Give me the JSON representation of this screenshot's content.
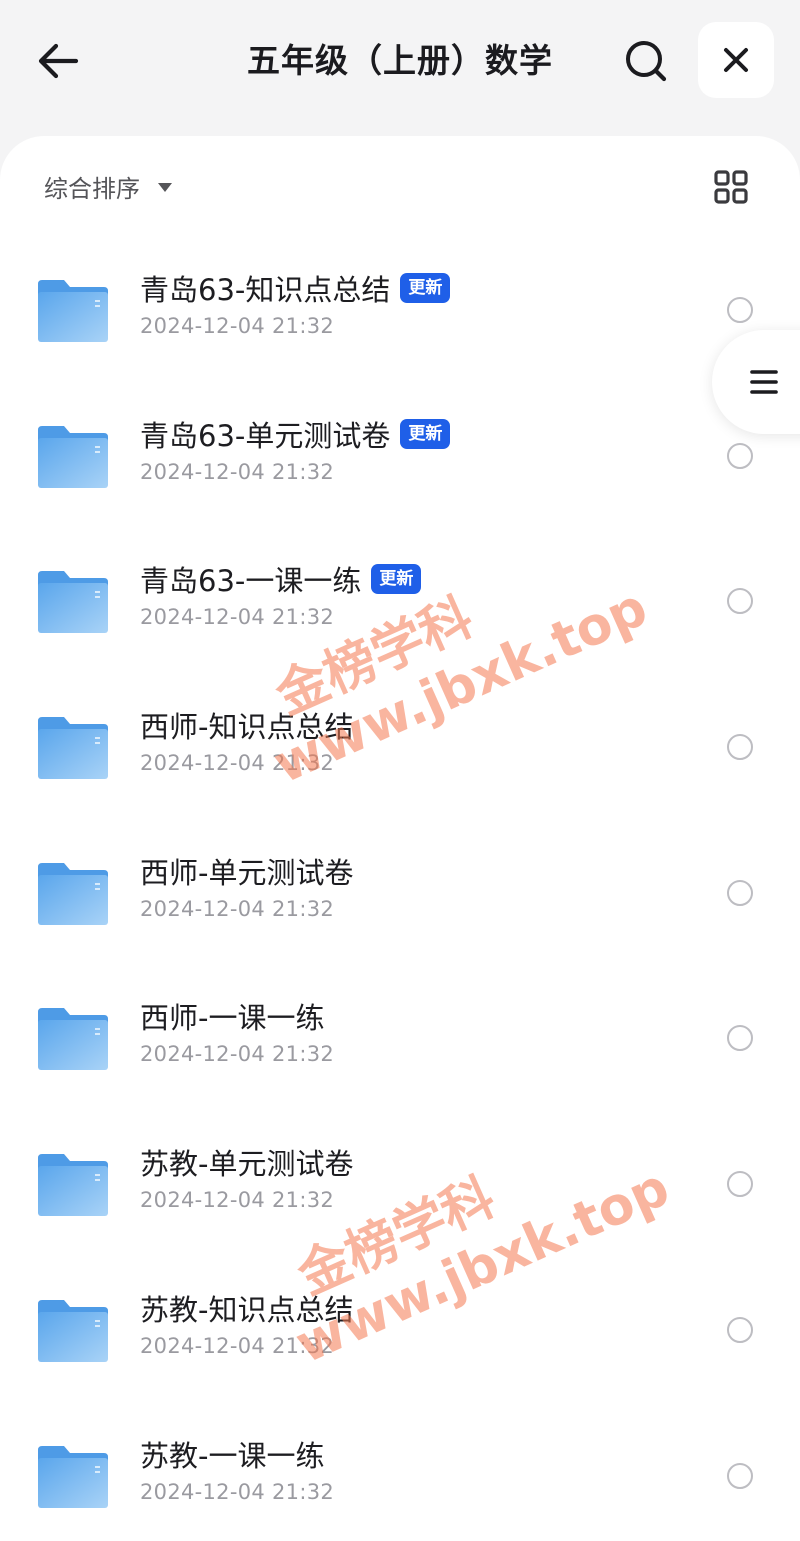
{
  "header": {
    "title": "五年级（上册）数学",
    "back_icon": "arrow-left-icon",
    "search_icon": "search-icon",
    "close_icon": "close-icon"
  },
  "toolbar": {
    "sort_label": "综合排序",
    "sort_icon": "caret-down-icon",
    "grid_icon": "grid-view-icon"
  },
  "side_menu": {
    "icon": "menu-icon"
  },
  "files": [
    {
      "name": "青岛63-知识点总结",
      "date": "2024-12-04 21:32",
      "badge": "更新"
    },
    {
      "name": "青岛63-单元测试卷",
      "date": "2024-12-04 21:32",
      "badge": "更新"
    },
    {
      "name": "青岛63-一课一练",
      "date": "2024-12-04 21:32",
      "badge": "更新"
    },
    {
      "name": "西师-知识点总结",
      "date": "2024-12-04 21:32",
      "badge": ""
    },
    {
      "name": "西师-单元测试卷",
      "date": "2024-12-04 21:32",
      "badge": ""
    },
    {
      "name": "西师-一课一练",
      "date": "2024-12-04 21:32",
      "badge": ""
    },
    {
      "name": "苏教-单元测试卷",
      "date": "2024-12-04 21:32",
      "badge": ""
    },
    {
      "name": "苏教-知识点总结",
      "date": "2024-12-04 21:32",
      "badge": ""
    },
    {
      "name": "苏教-一课一练",
      "date": "2024-12-04 21:32",
      "badge": ""
    }
  ],
  "watermarks": [
    {
      "line1": "金榜学科",
      "line2": "www.jbxk.top"
    },
    {
      "line1": "金榜学科",
      "line2": "www.jbxk.top"
    }
  ],
  "colors": {
    "badge": "#1f5fe8",
    "folder": "#7ab8f0",
    "watermark": "#f47850"
  }
}
